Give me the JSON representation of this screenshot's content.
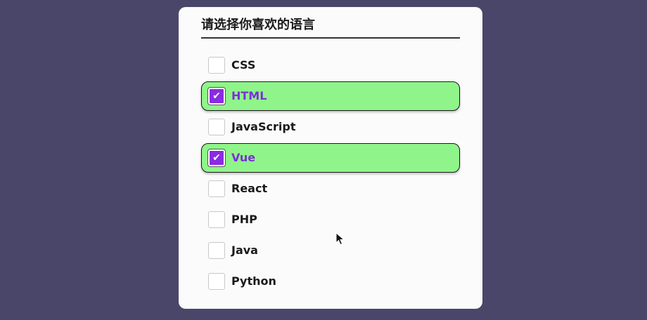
{
  "form": {
    "title": "请选择你喜欢的语言",
    "options": [
      {
        "label": "CSS",
        "checked": false
      },
      {
        "label": "HTML",
        "checked": true
      },
      {
        "label": "JavaScript",
        "checked": false
      },
      {
        "label": "Vue",
        "checked": true
      },
      {
        "label": "React",
        "checked": false
      },
      {
        "label": "PHP",
        "checked": false
      },
      {
        "label": "Java",
        "checked": false
      },
      {
        "label": "Python",
        "checked": false
      }
    ],
    "check_glyph": "✔"
  },
  "colors": {
    "page_background": "#4a4669",
    "card_background": "#fbfbfb",
    "checked_row_background": "#8ff58a",
    "checkbox_checked": "#8a2be2",
    "checked_label": "#7b30d6"
  },
  "cursor": {
    "icon": "mouse-pointer-icon"
  }
}
